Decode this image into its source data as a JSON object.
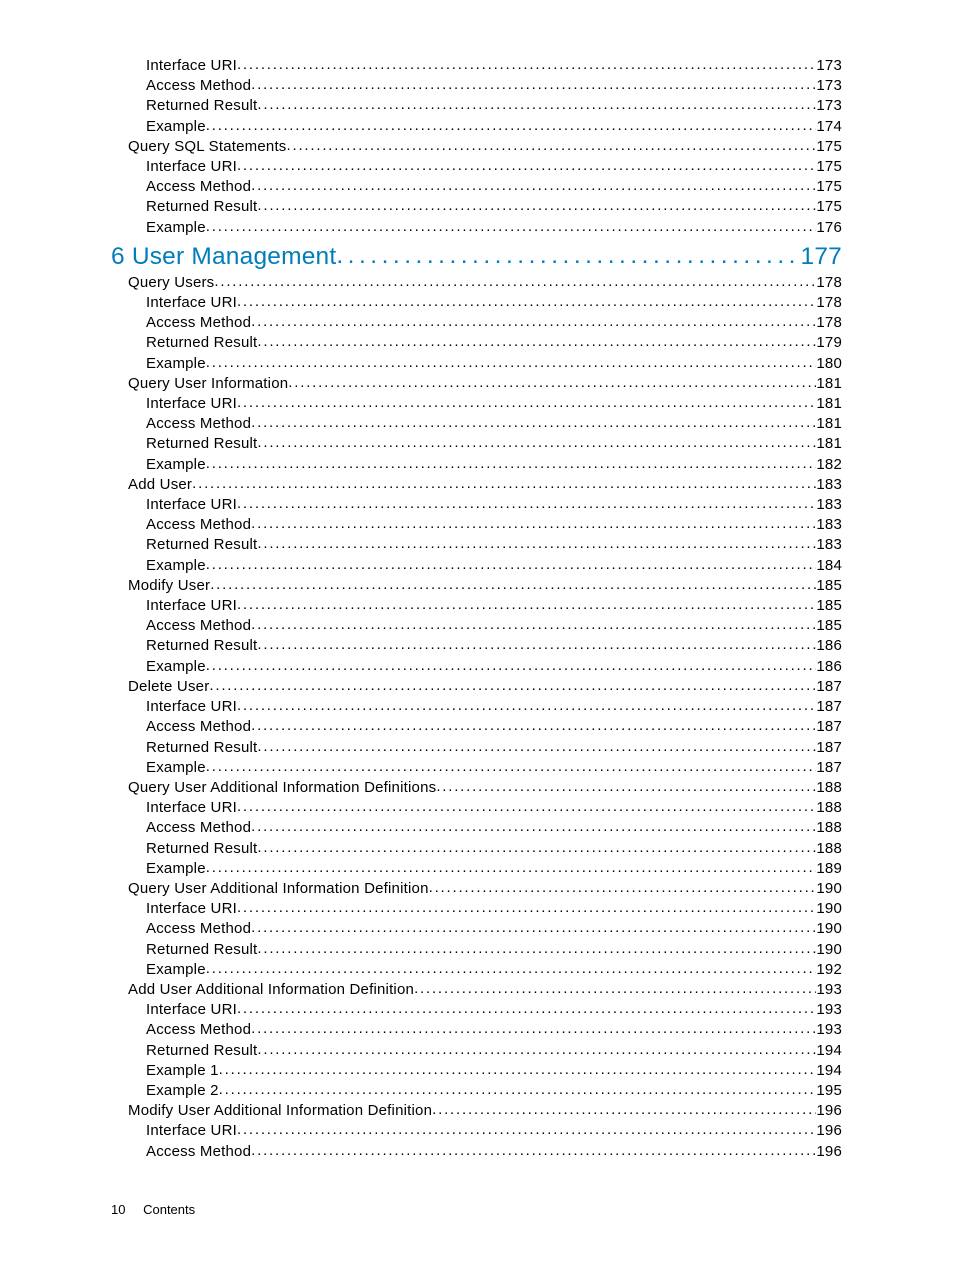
{
  "footer": {
    "page_number": "10",
    "label": "Contents"
  },
  "toc": [
    {
      "level": 3,
      "title": "Interface URI",
      "page": "173"
    },
    {
      "level": 3,
      "title": "Access Method",
      "page": "173"
    },
    {
      "level": 3,
      "title": "Returned Result",
      "page": "173"
    },
    {
      "level": 3,
      "title": "Example",
      "page": "174"
    },
    {
      "level": 2,
      "title": "Query SQL Statements",
      "page": "175"
    },
    {
      "level": 3,
      "title": "Interface URI",
      "page": "175"
    },
    {
      "level": 3,
      "title": "Access Method",
      "page": "175"
    },
    {
      "level": 3,
      "title": "Returned Result",
      "page": "175"
    },
    {
      "level": 3,
      "title": "Example",
      "page": "176"
    },
    {
      "level": 1,
      "title": "6 User Management",
      "page": "177"
    },
    {
      "level": 2,
      "title": "Query Users",
      "page": "178"
    },
    {
      "level": 3,
      "title": "Interface URI",
      "page": "178"
    },
    {
      "level": 3,
      "title": "Access Method",
      "page": "178"
    },
    {
      "level": 3,
      "title": "Returned Result",
      "page": "179"
    },
    {
      "level": 3,
      "title": "Example",
      "page": "180"
    },
    {
      "level": 2,
      "title": "Query User Information",
      "page": "181"
    },
    {
      "level": 3,
      "title": "Interface URI",
      "page": "181"
    },
    {
      "level": 3,
      "title": "Access Method",
      "page": "181"
    },
    {
      "level": 3,
      "title": "Returned Result",
      "page": "181"
    },
    {
      "level": 3,
      "title": "Example",
      "page": "182"
    },
    {
      "level": 2,
      "title": "Add User",
      "page": "183"
    },
    {
      "level": 3,
      "title": "Interface URI",
      "page": "183"
    },
    {
      "level": 3,
      "title": "Access Method",
      "page": "183"
    },
    {
      "level": 3,
      "title": "Returned Result",
      "page": "183"
    },
    {
      "level": 3,
      "title": "Example",
      "page": "184"
    },
    {
      "level": 2,
      "title": "Modify User",
      "page": "185"
    },
    {
      "level": 3,
      "title": "Interface URI",
      "page": "185"
    },
    {
      "level": 3,
      "title": "Access Method",
      "page": "185"
    },
    {
      "level": 3,
      "title": "Returned Result",
      "page": "186"
    },
    {
      "level": 3,
      "title": "Example",
      "page": "186"
    },
    {
      "level": 2,
      "title": "Delete User",
      "page": "187"
    },
    {
      "level": 3,
      "title": "Interface URI",
      "page": "187"
    },
    {
      "level": 3,
      "title": "Access Method",
      "page": "187"
    },
    {
      "level": 3,
      "title": "Returned Result",
      "page": "187"
    },
    {
      "level": 3,
      "title": "Example",
      "page": "187"
    },
    {
      "level": 2,
      "title": "Query User Additional Information Definitions",
      "page": "188"
    },
    {
      "level": 3,
      "title": "Interface URI",
      "page": "188"
    },
    {
      "level": 3,
      "title": "Access Method",
      "page": "188"
    },
    {
      "level": 3,
      "title": "Returned Result",
      "page": "188"
    },
    {
      "level": 3,
      "title": "Example",
      "page": "189"
    },
    {
      "level": 2,
      "title": "Query User Additional Information Definition",
      "page": "190"
    },
    {
      "level": 3,
      "title": "Interface URI",
      "page": "190"
    },
    {
      "level": 3,
      "title": "Access Method",
      "page": "190"
    },
    {
      "level": 3,
      "title": "Returned Result",
      "page": "190"
    },
    {
      "level": 3,
      "title": "Example",
      "page": "192"
    },
    {
      "level": 2,
      "title": "Add User Additional Information Definition",
      "page": "193"
    },
    {
      "level": 3,
      "title": "Interface URI",
      "page": "193"
    },
    {
      "level": 3,
      "title": "Access Method",
      "page": "193"
    },
    {
      "level": 3,
      "title": "Returned Result",
      "page": "194"
    },
    {
      "level": 3,
      "title": "Example 1",
      "page": "194"
    },
    {
      "level": 3,
      "title": "Example 2",
      "page": "195"
    },
    {
      "level": 2,
      "title": "Modify User Additional Information Definition",
      "page": "196"
    },
    {
      "level": 3,
      "title": "Interface URI",
      "page": "196"
    },
    {
      "level": 3,
      "title": "Access Method",
      "page": "196"
    }
  ]
}
